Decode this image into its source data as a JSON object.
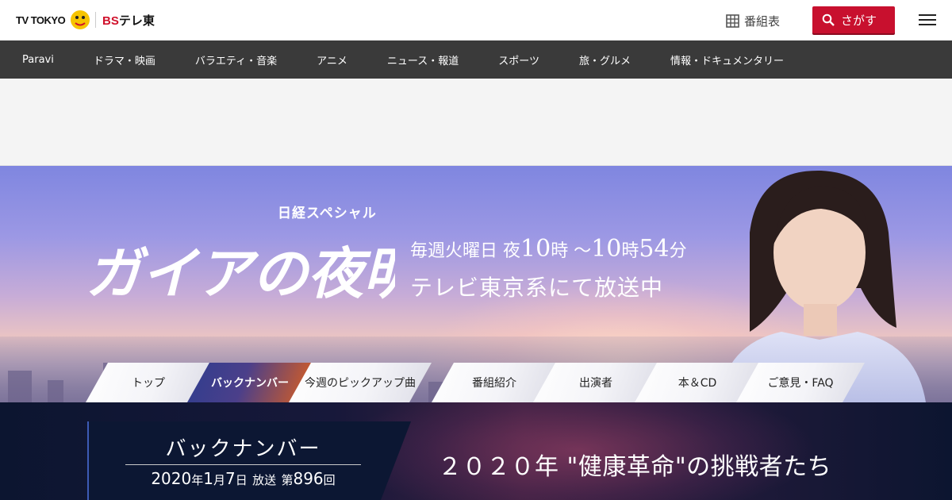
{
  "header": {
    "logo_tvtokyo": "TV TOKYO",
    "logo_bs_prefix": "BS",
    "logo_bs_suffix": "テレ東",
    "program_guide_label": "番組表",
    "search_label": "さがす",
    "icons": {
      "grid": "program-guide-grid-icon",
      "search": "search-icon",
      "menu": "hamburger-menu-icon"
    }
  },
  "nav": {
    "items": [
      "Paravi",
      "ドラマ・映画",
      "バラエティ・音楽",
      "アニメ",
      "ニュース・報道",
      "スポーツ",
      "旅・グルメ",
      "情報・ドキュメンタリー"
    ]
  },
  "hero": {
    "series_label": "日経スペシャル",
    "title": "ガイアの夜明け",
    "schedule_prefix": "毎週火曜日 夜",
    "start_hour": "10",
    "start_suffix": "時 ～",
    "end_hour": "10",
    "end_hour_suffix": "時",
    "end_minute": "54",
    "end_minute_suffix": "分",
    "broadcast_note": "テレビ東京系にて放送中"
  },
  "tabs": {
    "items": [
      "トップ",
      "バックナンバー",
      "今週のピックアップ曲",
      "番組紹介",
      "出演者",
      "本＆CD",
      "ご意見・FAQ"
    ],
    "active_index": 1
  },
  "episode": {
    "section_title": "バックナンバー",
    "year": "2020",
    "year_unit": "年",
    "month": "1",
    "month_unit": "月",
    "day": "7",
    "day_unit": "日",
    "broadcast_word": "放送",
    "episode_prefix": "第",
    "episode_number": "896",
    "episode_unit": "回",
    "title": "２０２０年 \"健康革命\"の挑戦者たち"
  },
  "colors": {
    "accent_red": "#c8102e",
    "nav_bg": "#3a3a3a",
    "bottom_bg": "#0c1530"
  }
}
